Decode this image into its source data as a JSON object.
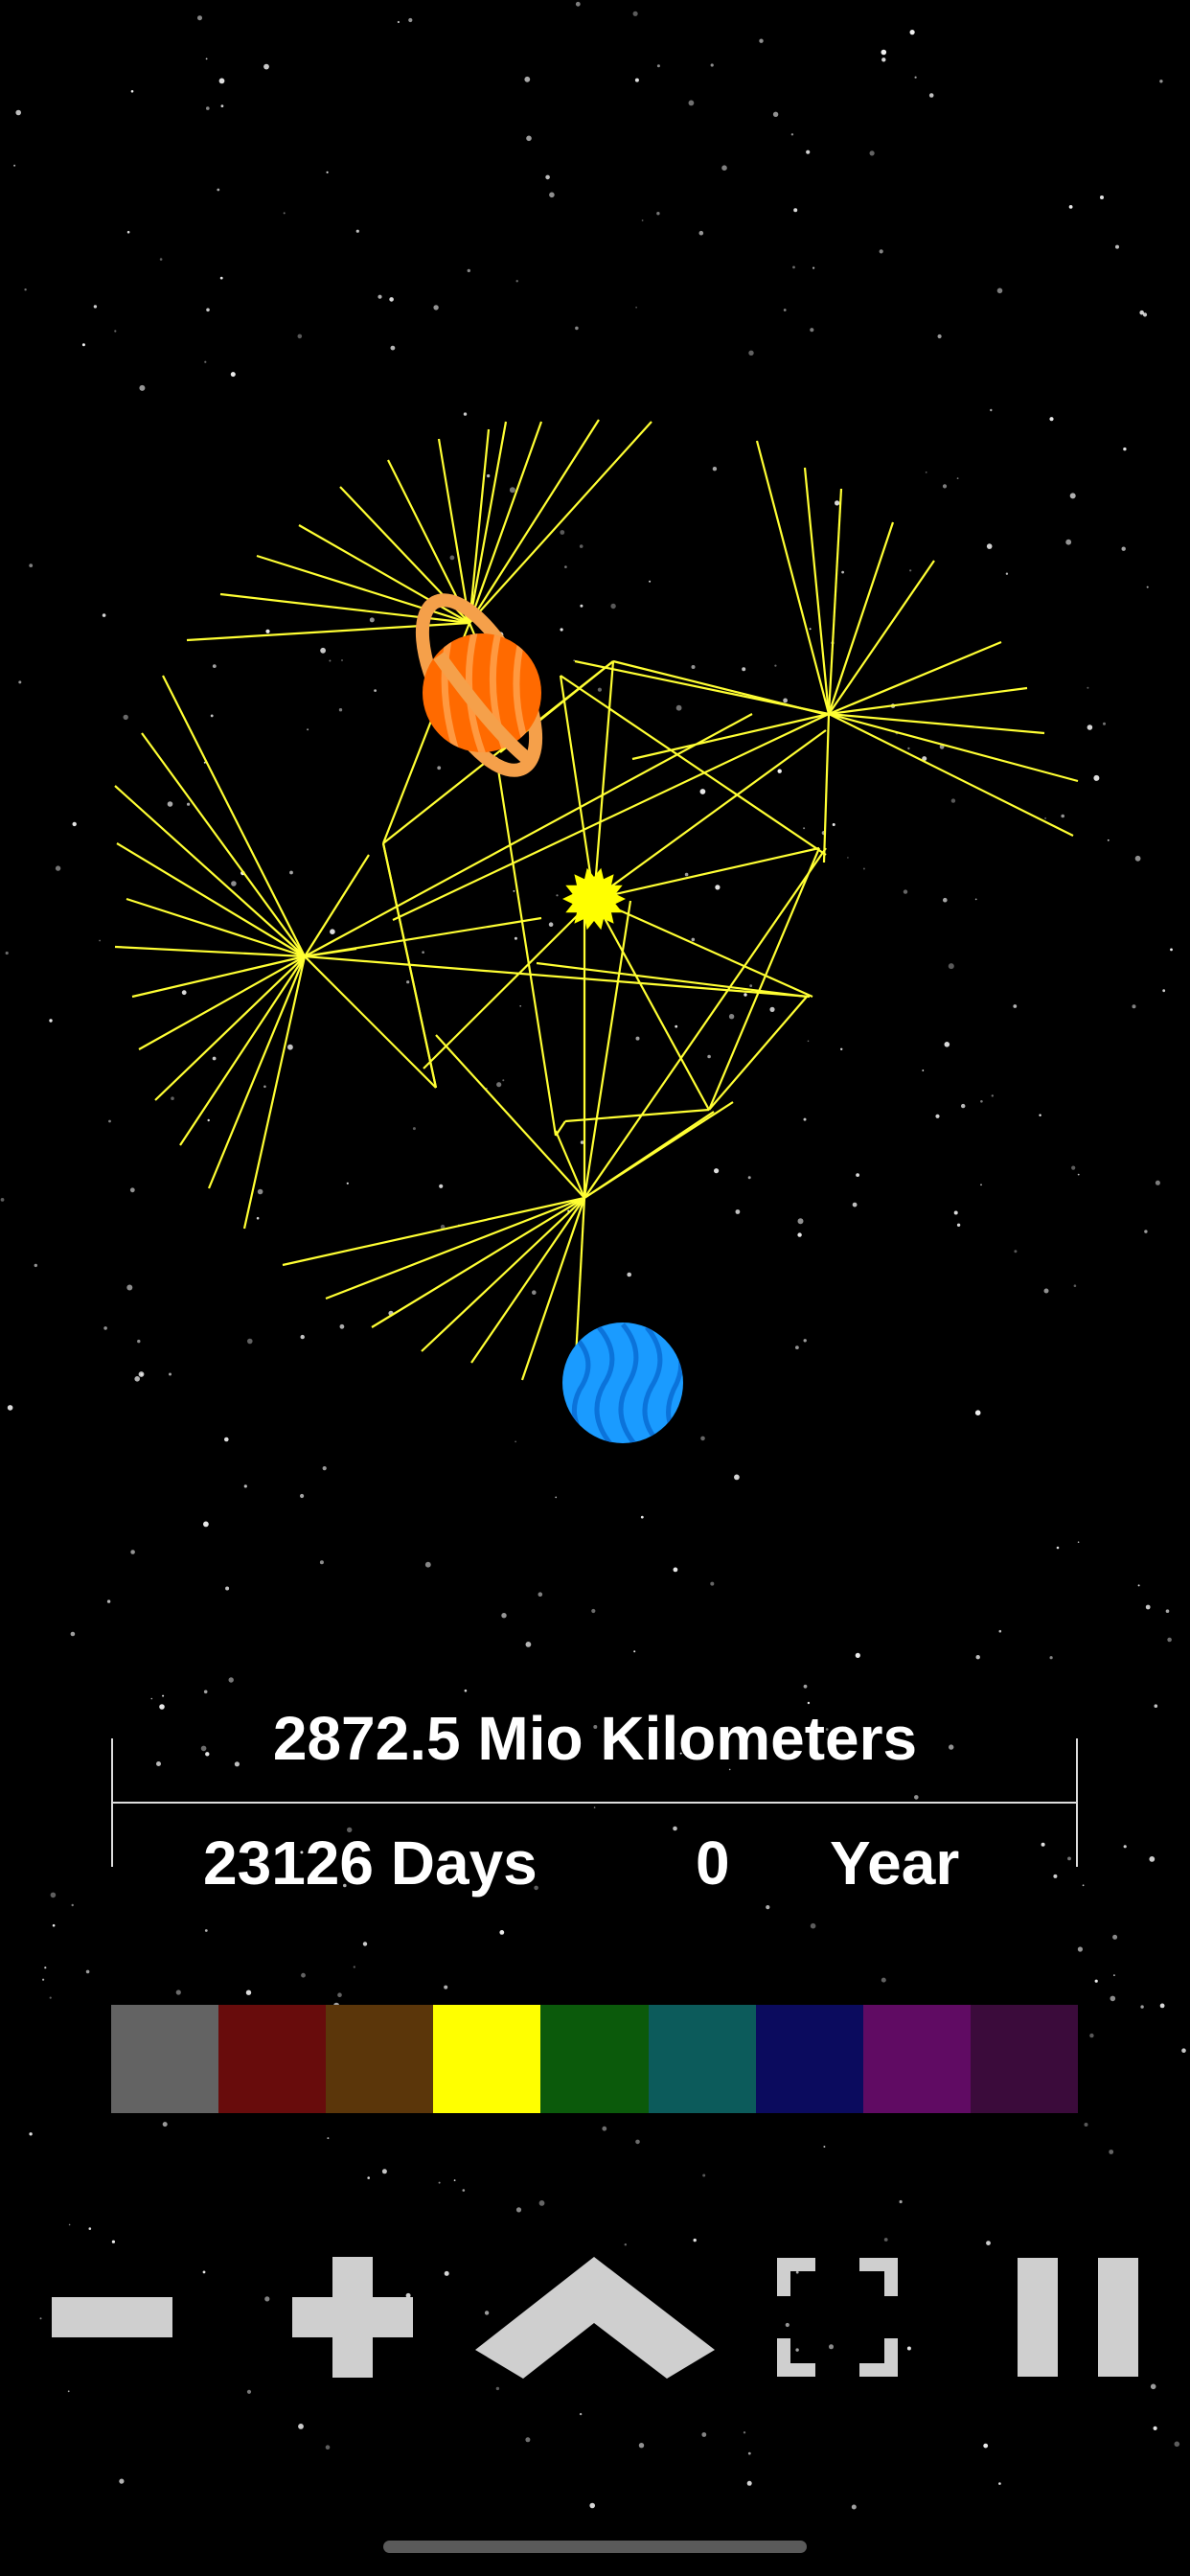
{
  "readout": {
    "distance": "2872.5 Mio Kilometers",
    "days": "23126 Days",
    "years": "0",
    "year_unit": "Year"
  },
  "palette": {
    "colors": [
      "#636363",
      "#680c0c",
      "#5b360a",
      "#ffff00",
      "#0b5a0b",
      "#0c5b5b",
      "#0b0b5e",
      "#600b63",
      "#3b0b3b"
    ]
  },
  "controls": {
    "buttons": [
      "minus-icon",
      "plus-icon",
      "chevron-up-icon",
      "fullscreen-icon",
      "pause-icon"
    ]
  },
  "scene": {
    "line_color": "#ffff33",
    "sun_color": "#ffff00",
    "saturn_color": "#ff6a00",
    "neptune_color": "#1a9bff"
  }
}
